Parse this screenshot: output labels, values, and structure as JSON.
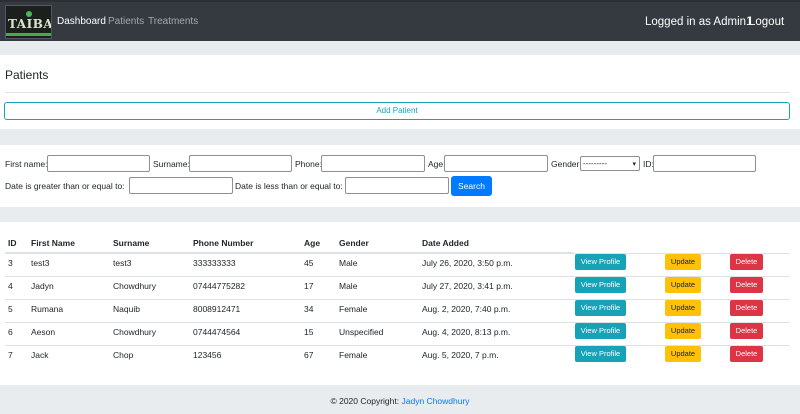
{
  "nav": {
    "logo_text": "TAIBA",
    "links": [
      "Dashboard",
      "Patients",
      "Treatments"
    ],
    "logged_in": "Logged in as Admin1",
    "logout": "Logout"
  },
  "patients_card": {
    "title": "Patients",
    "add_button": "Add Patient"
  },
  "filters": {
    "first_name_label": "First name:",
    "surname_label": "Surname:",
    "phone_label": "Phone:",
    "age_label": "Age:",
    "gender_label": "Gender:",
    "gender_value": "---------",
    "id_label": "ID:",
    "date_gte_label": "Date is greater than or equal to:",
    "date_lte_label": "Date is less than or equal to:",
    "search_button": "Search"
  },
  "table": {
    "headers": [
      "ID",
      "First Name",
      "Surname",
      "Phone Number",
      "Age",
      "Gender",
      "Date Added"
    ],
    "rows": [
      [
        "3",
        "test3",
        "test3",
        "333333333",
        "45",
        "Male",
        "July 26, 2020, 3:50 p.m."
      ],
      [
        "4",
        "Jadyn",
        "Chowdhury",
        "07444775282",
        "17",
        "Male",
        "July 27, 2020, 3:41 p.m."
      ],
      [
        "5",
        "Rumana",
        "Naquib",
        "8008912471",
        "34",
        "Female",
        "Aug. 2, 2020, 7:40 p.m."
      ],
      [
        "6",
        "Aeson",
        "Chowdhury",
        "0744474564",
        "15",
        "Unspecified",
        "Aug. 4, 2020, 8:13 p.m."
      ],
      [
        "7",
        "Jack",
        "Chop",
        "123456",
        "67",
        "Female",
        "Aug. 5, 2020, 7 p.m."
      ]
    ],
    "view_label": "View Profile",
    "update_label": "Update",
    "delete_label": "Delete"
  },
  "footer": {
    "copyright": "© 2020 Copyright:",
    "author": "Jadyn Chowdhury"
  },
  "colors": {
    "navbar": "#343a40",
    "primary": "#007bff",
    "info": "#17a2b8",
    "warning": "#ffc107",
    "danger": "#dc3545"
  }
}
